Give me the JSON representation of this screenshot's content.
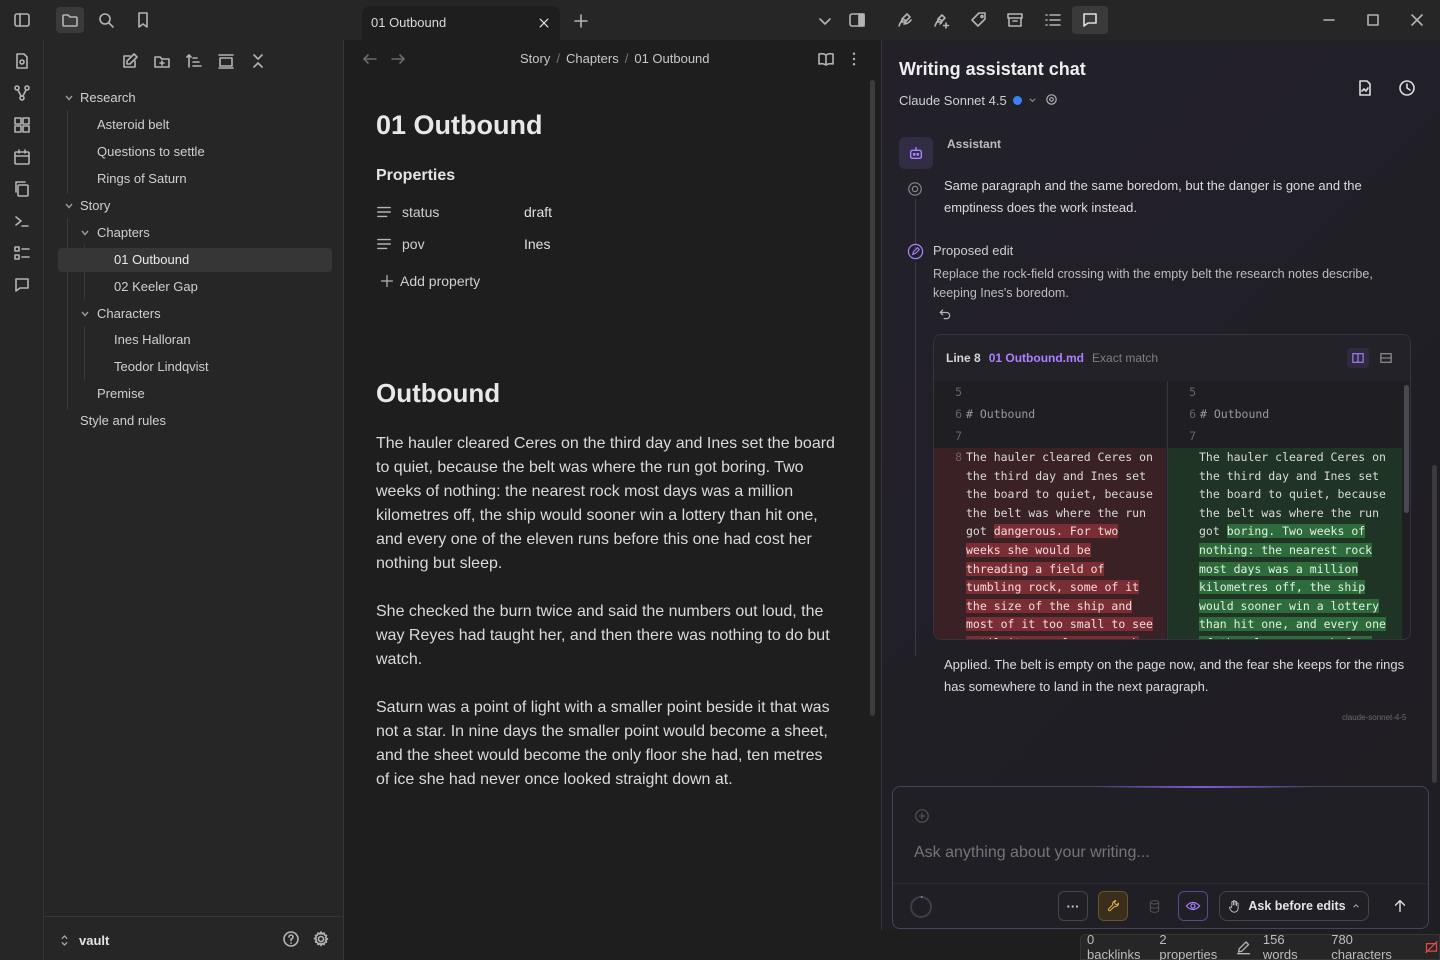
{
  "tabs": [
    {
      "title": "01 Outbound"
    }
  ],
  "sidebar": {
    "tree": [
      {
        "label": "Research",
        "type": "folder",
        "level": 0,
        "expanded": true
      },
      {
        "label": "Asteroid belt",
        "type": "file",
        "level": 1
      },
      {
        "label": "Questions to settle",
        "type": "file",
        "level": 1
      },
      {
        "label": "Rings of Saturn",
        "type": "file",
        "level": 1
      },
      {
        "label": "Story",
        "type": "folder",
        "level": 0,
        "expanded": true
      },
      {
        "label": "Chapters",
        "type": "folder",
        "level": 1,
        "expanded": true
      },
      {
        "label": "01 Outbound",
        "type": "file",
        "level": 2,
        "active": true
      },
      {
        "label": "02 Keeler Gap",
        "type": "file",
        "level": 2
      },
      {
        "label": "Characters",
        "type": "folder",
        "level": 1,
        "expanded": true
      },
      {
        "label": "Ines Halloran",
        "type": "file",
        "level": 2
      },
      {
        "label": "Teodor Lindqvist",
        "type": "file",
        "level": 2
      },
      {
        "label": "Premise",
        "type": "file",
        "level": 1
      },
      {
        "label": "Style and rules",
        "type": "file",
        "level": 0
      }
    ],
    "vault_name": "vault"
  },
  "editor": {
    "breadcrumb": [
      "Story",
      "Chapters",
      "01 Outbound"
    ],
    "breadcrumb_sep": "/",
    "title": "01 Outbound",
    "properties_heading": "Properties",
    "properties": [
      {
        "key": "status",
        "value": "draft"
      },
      {
        "key": "pov",
        "value": "Ines"
      }
    ],
    "add_property_label": "Add property",
    "heading": "Outbound",
    "paragraphs": [
      "The hauler cleared Ceres on the third day and Ines set the board to quiet, because the belt was where the run got boring. Two weeks of nothing: the nearest rock most days was a million kilometres off, the ship would sooner win a lottery than hit one, and every one of the eleven runs before this one had cost her nothing but sleep.",
      "She checked the burn twice and said the numbers out loud, the way Reyes had taught her, and then there was nothing to do but watch.",
      "Saturn was a point of light with a smaller point beside it that was not a star. In nine days the smaller point would become a sheet, and the sheet would become the only floor she had, ten metres of ice she had never once looked straight down at."
    ]
  },
  "chat": {
    "title": "Writing assistant chat",
    "model": "Claude Sonnet 4.5",
    "assistant_label": "Assistant",
    "message_1": "Same paragraph and the same boredom, but the danger is gone and the emptiness does the work instead.",
    "proposed_edit_label": "Proposed edit",
    "proposed_edit_desc": "Replace the rock-field crossing with the empty belt the research notes describe, keeping Ines's boredom.",
    "diff": {
      "line_label": "Line 8",
      "file": "01 Outbound.md",
      "match": "Exact match",
      "context": [
        {
          "num": "5",
          "text": ""
        },
        {
          "num": "6",
          "text": "# Outbound"
        },
        {
          "num": "7",
          "text": ""
        }
      ],
      "changed_num": "8",
      "old_lines": [
        "The hauler cleared Ceres on",
        "the third day and Ines set",
        "the board to quiet, because",
        "the belt was where the run",
        "got dangerous. For two",
        "weeks she would be",
        "threading a field of",
        "tumbling rock, some of it",
        "the size of the ship and",
        "most of it too small to see",
        "until it was close enough"
      ],
      "new_lines": [
        "The hauler cleared Ceres on",
        "the third day and Ines set",
        "the board to quiet, because",
        "the belt was where the run",
        "got boring. Two weeks of",
        "nothing: the nearest rock",
        "most days was a million",
        "kilometres off, the ship",
        "would sooner win a lottery",
        "than hit one, and every one",
        "of the eleven runs before"
      ]
    },
    "message_2": "Applied. The belt is empty on the page now, and the fear she keeps for the rings has somewhere to land in the next paragraph.",
    "model_tag": "claude-sonnet-4-5",
    "input_placeholder": "Ask anything about your writing...",
    "more_label": "···",
    "mode_label": "Ask before edits"
  },
  "status": {
    "backlinks": "0 backlinks",
    "properties": "2 properties",
    "words": "156 words",
    "characters": "780 characters"
  },
  "colors": {
    "accent": "#a882ff",
    "dot": "#3b82f6",
    "deletion": "#7a2d34",
    "addition": "#2d6b3a",
    "wrench": "#e0a84a"
  }
}
